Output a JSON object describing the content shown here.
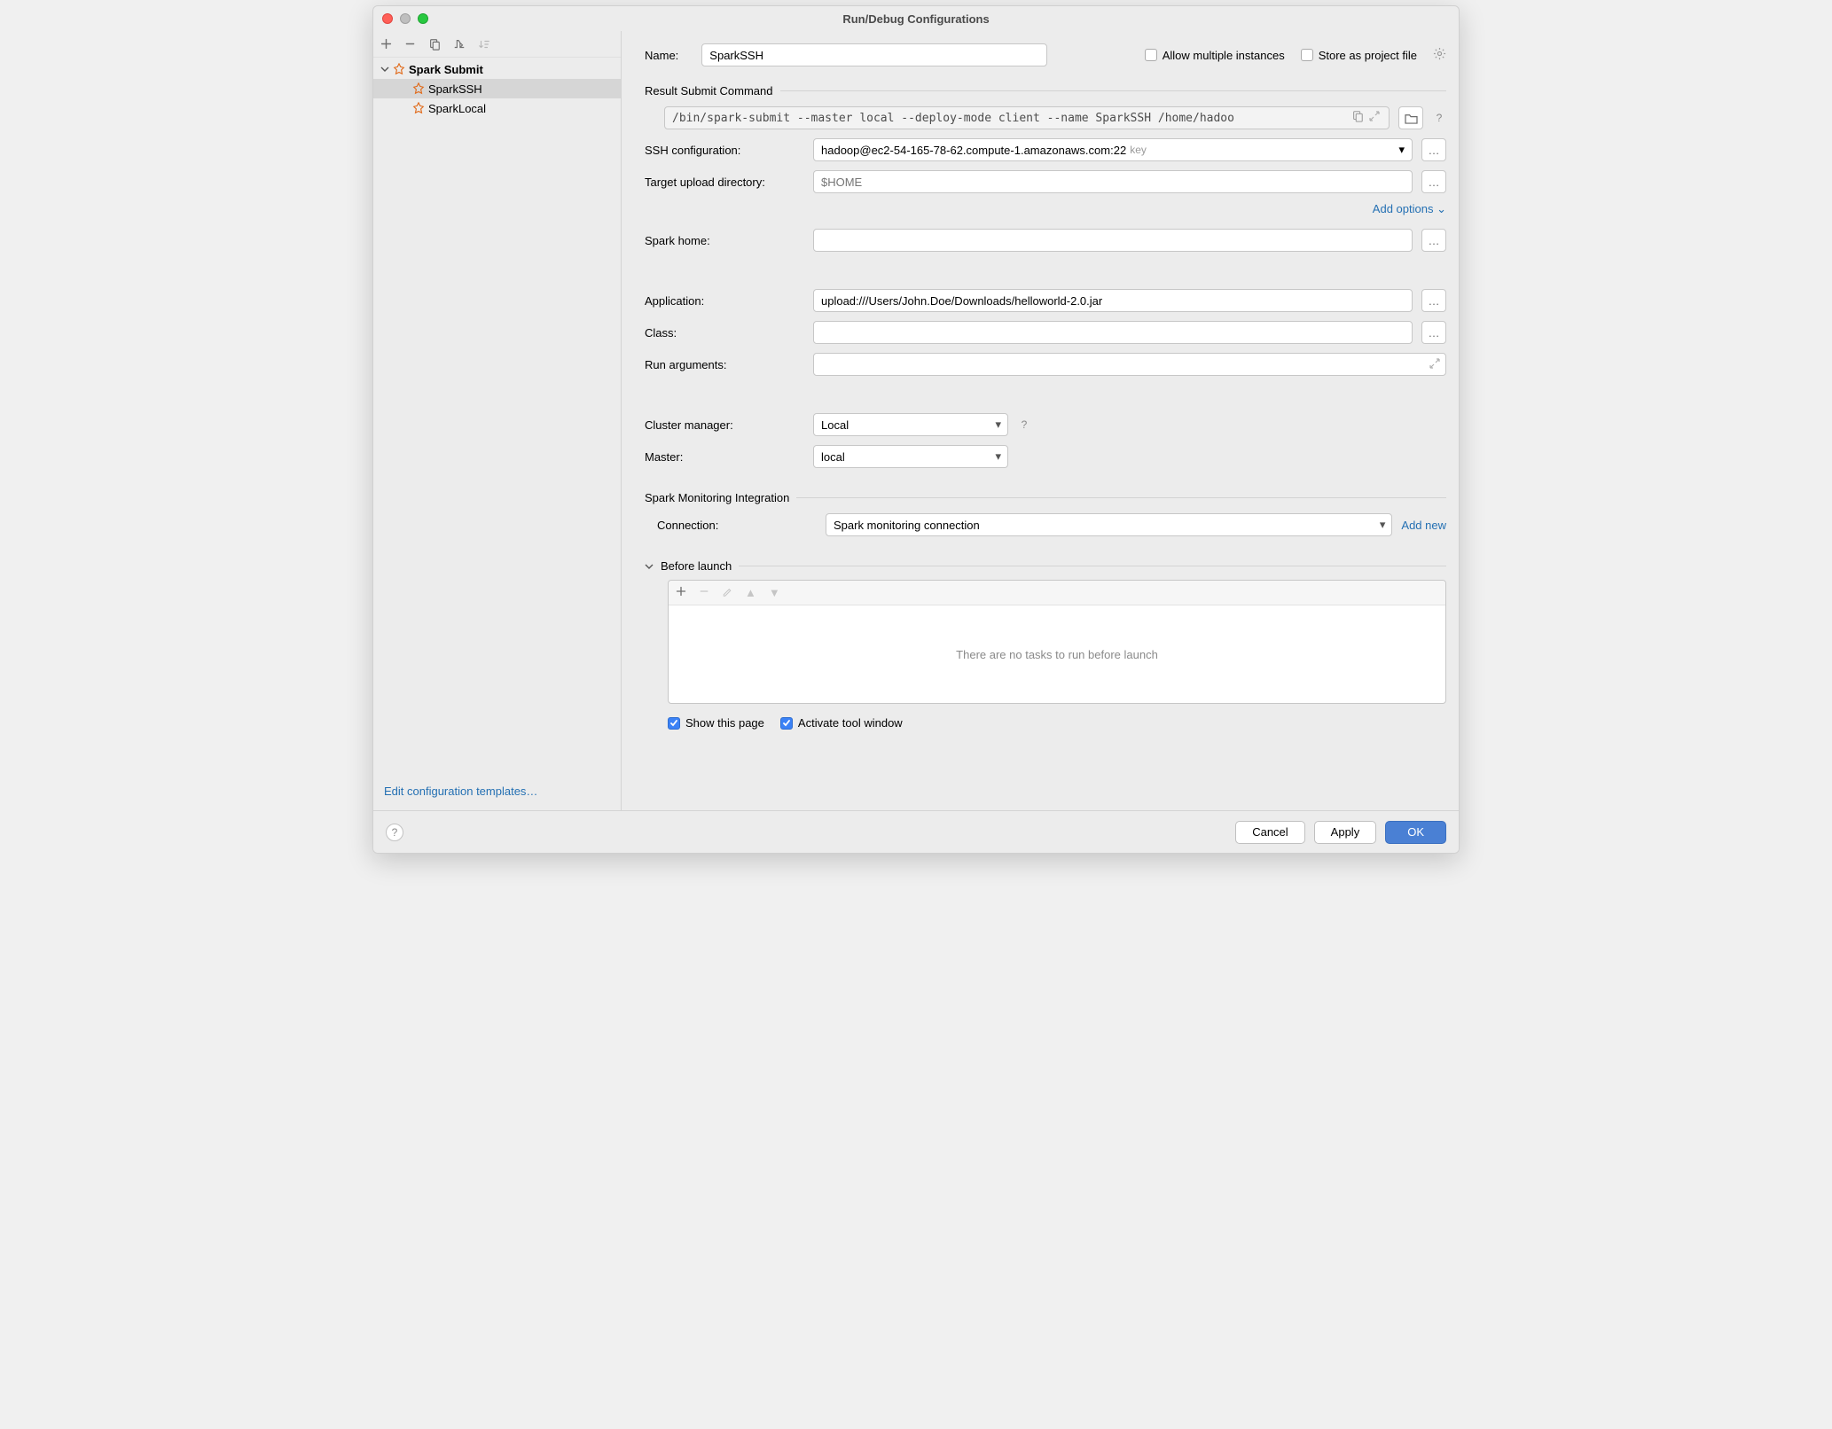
{
  "window": {
    "title": "Run/Debug Configurations"
  },
  "sidebar": {
    "root": {
      "label": "Spark Submit"
    },
    "items": [
      {
        "label": "SparkSSH",
        "selected": true
      },
      {
        "label": "SparkLocal",
        "selected": false
      }
    ],
    "edit_templates": "Edit configuration templates…"
  },
  "toprow": {
    "name_label": "Name:",
    "name_value": "SparkSSH",
    "allow_multiple_label": "Allow multiple instances",
    "store_project_label": "Store as project file"
  },
  "result_section": {
    "title": "Result Submit Command",
    "command": "/bin/spark-submit --master local --deploy-mode client --name SparkSSH /home/hadoo"
  },
  "fields": {
    "ssh_label": "SSH configuration:",
    "ssh_value": "hadoop@ec2-54-165-78-62.compute-1.amazonaws.com:22",
    "ssh_hint": "key",
    "target_label": "Target upload directory:",
    "target_placeholder": "$HOME",
    "add_options": "Add options",
    "spark_home_label": "Spark home:",
    "spark_home_value": "",
    "application_label": "Application:",
    "application_value": "upload:///Users/John.Doe/Downloads/helloworld-2.0.jar",
    "class_label": "Class:",
    "class_value": "",
    "run_args_label": "Run arguments:",
    "run_args_value": "",
    "cluster_mgr_label": "Cluster manager:",
    "cluster_mgr_value": "Local",
    "master_label": "Master:",
    "master_value": "local"
  },
  "monitoring": {
    "title": "Spark Monitoring Integration",
    "connection_label": "Connection:",
    "connection_value": "Spark monitoring connection",
    "add_new": "Add new"
  },
  "before_launch": {
    "title": "Before launch",
    "empty_text": "There are no tasks to run before launch"
  },
  "bottom": {
    "show_page": "Show this page",
    "activate_tool": "Activate tool window"
  },
  "footer": {
    "cancel": "Cancel",
    "apply": "Apply",
    "ok": "OK"
  }
}
